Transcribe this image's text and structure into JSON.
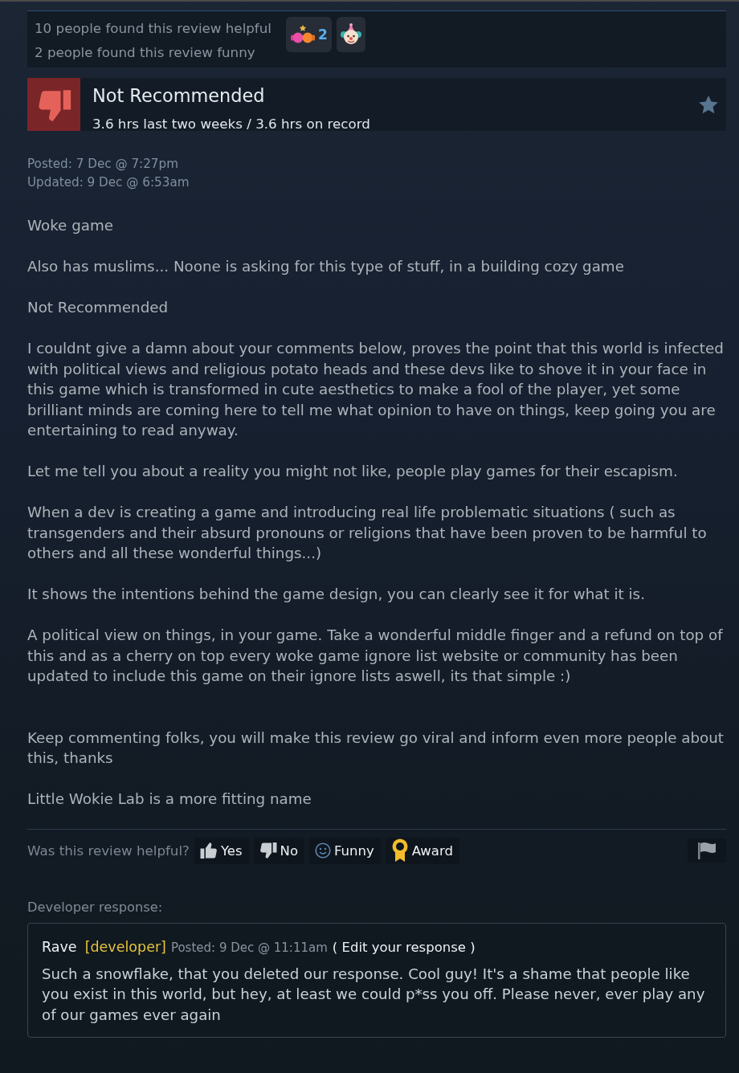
{
  "summary": {
    "lines": [
      "10 people found this review helpful",
      "2 people found this review funny"
    ],
    "awards": [
      {
        "kind": "gloves",
        "count": "2"
      },
      {
        "kind": "clown"
      }
    ]
  },
  "review": {
    "recommended": false,
    "verdict": "Not Recommended",
    "hours": "3.6 hrs last two weeks / 3.6 hrs on record",
    "posted": "Posted: 7 Dec @ 7:27pm",
    "updated": "Updated: 9 Dec @ 6:53am",
    "body_sections": [
      [
        "Woke game",
        "Also has muslims... Noone is asking for this type of stuff, in a building cozy game",
        "Not Recommended",
        "I couldnt give a damn about your comments below, proves the point that this world is infected with political views and religious potato heads and these devs like to shove it in your face in this game which is transformed in cute aesthetics to make a fool of the player, yet some brilliant minds are coming here to tell me what opinion to have on things, keep going you are entertaining to read anyway.",
        "Let me tell you about a reality you might not like, people play games for their escapism.",
        "When a dev is creating a game and introducing real life problematic situations ( such as transgenders and their absurd pronouns or religions that have been proven to be harmful to others and all these wonderful things...)",
        "It shows the intentions behind the game design, you can clearly see it for what it is.",
        "A political view on things, in your game. Take a wonderful middle finger and a refund on top of this and as a cherry on top every woke game ignore list website or community has been updated to include this game on their ignore lists aswell, its that simple :)"
      ],
      [
        "Keep commenting folks, you will make this review go viral and inform even more people about this, thanks",
        "Little Wokie Lab is a more fitting name"
      ]
    ]
  },
  "vote_bar": {
    "prompt": "Was this review helpful?",
    "buttons": [
      {
        "kind": "yes",
        "label": "Yes"
      },
      {
        "kind": "no",
        "label": "No"
      },
      {
        "kind": "funny",
        "label": "Funny"
      },
      {
        "kind": "award",
        "label": "Award"
      }
    ]
  },
  "developer_response": {
    "heading": "Developer response:",
    "author": "Rave",
    "role": "[developer]",
    "posted": "Posted: 9 Dec @ 11:11am",
    "edit_link": "( Edit your response )",
    "text": "Such a snowflake, that you deleted our response. Cool guy! It's a shame that people like you exist in this world, but hey, at least we could p*ss you off. Please never, ever play any of our games ever again"
  }
}
